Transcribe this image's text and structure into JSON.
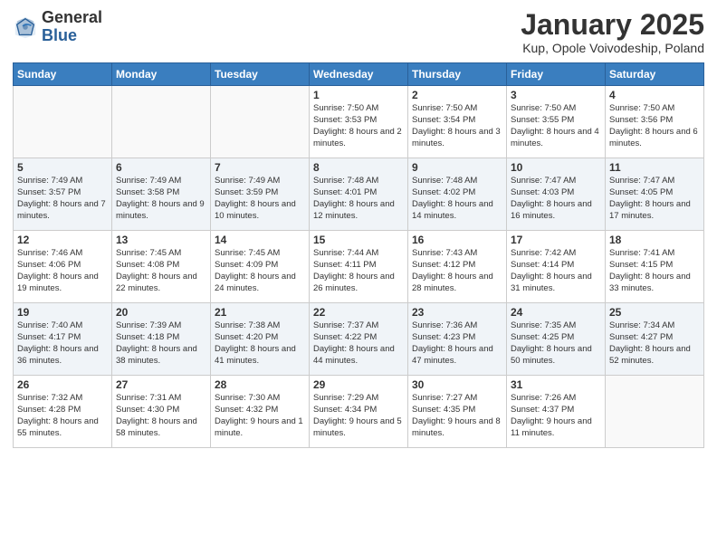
{
  "header": {
    "logo_general": "General",
    "logo_blue": "Blue",
    "month_title": "January 2025",
    "location": "Kup, Opole Voivodeship, Poland"
  },
  "weekdays": [
    "Sunday",
    "Monday",
    "Tuesday",
    "Wednesday",
    "Thursday",
    "Friday",
    "Saturday"
  ],
  "weeks": [
    [
      {
        "day": "",
        "info": ""
      },
      {
        "day": "",
        "info": ""
      },
      {
        "day": "",
        "info": ""
      },
      {
        "day": "1",
        "info": "Sunrise: 7:50 AM\nSunset: 3:53 PM\nDaylight: 8 hours and 2 minutes."
      },
      {
        "day": "2",
        "info": "Sunrise: 7:50 AM\nSunset: 3:54 PM\nDaylight: 8 hours and 3 minutes."
      },
      {
        "day": "3",
        "info": "Sunrise: 7:50 AM\nSunset: 3:55 PM\nDaylight: 8 hours and 4 minutes."
      },
      {
        "day": "4",
        "info": "Sunrise: 7:50 AM\nSunset: 3:56 PM\nDaylight: 8 hours and 6 minutes."
      }
    ],
    [
      {
        "day": "5",
        "info": "Sunrise: 7:49 AM\nSunset: 3:57 PM\nDaylight: 8 hours and 7 minutes."
      },
      {
        "day": "6",
        "info": "Sunrise: 7:49 AM\nSunset: 3:58 PM\nDaylight: 8 hours and 9 minutes."
      },
      {
        "day": "7",
        "info": "Sunrise: 7:49 AM\nSunset: 3:59 PM\nDaylight: 8 hours and 10 minutes."
      },
      {
        "day": "8",
        "info": "Sunrise: 7:48 AM\nSunset: 4:01 PM\nDaylight: 8 hours and 12 minutes."
      },
      {
        "day": "9",
        "info": "Sunrise: 7:48 AM\nSunset: 4:02 PM\nDaylight: 8 hours and 14 minutes."
      },
      {
        "day": "10",
        "info": "Sunrise: 7:47 AM\nSunset: 4:03 PM\nDaylight: 8 hours and 16 minutes."
      },
      {
        "day": "11",
        "info": "Sunrise: 7:47 AM\nSunset: 4:05 PM\nDaylight: 8 hours and 17 minutes."
      }
    ],
    [
      {
        "day": "12",
        "info": "Sunrise: 7:46 AM\nSunset: 4:06 PM\nDaylight: 8 hours and 19 minutes."
      },
      {
        "day": "13",
        "info": "Sunrise: 7:45 AM\nSunset: 4:08 PM\nDaylight: 8 hours and 22 minutes."
      },
      {
        "day": "14",
        "info": "Sunrise: 7:45 AM\nSunset: 4:09 PM\nDaylight: 8 hours and 24 minutes."
      },
      {
        "day": "15",
        "info": "Sunrise: 7:44 AM\nSunset: 4:11 PM\nDaylight: 8 hours and 26 minutes."
      },
      {
        "day": "16",
        "info": "Sunrise: 7:43 AM\nSunset: 4:12 PM\nDaylight: 8 hours and 28 minutes."
      },
      {
        "day": "17",
        "info": "Sunrise: 7:42 AM\nSunset: 4:14 PM\nDaylight: 8 hours and 31 minutes."
      },
      {
        "day": "18",
        "info": "Sunrise: 7:41 AM\nSunset: 4:15 PM\nDaylight: 8 hours and 33 minutes."
      }
    ],
    [
      {
        "day": "19",
        "info": "Sunrise: 7:40 AM\nSunset: 4:17 PM\nDaylight: 8 hours and 36 minutes."
      },
      {
        "day": "20",
        "info": "Sunrise: 7:39 AM\nSunset: 4:18 PM\nDaylight: 8 hours and 38 minutes."
      },
      {
        "day": "21",
        "info": "Sunrise: 7:38 AM\nSunset: 4:20 PM\nDaylight: 8 hours and 41 minutes."
      },
      {
        "day": "22",
        "info": "Sunrise: 7:37 AM\nSunset: 4:22 PM\nDaylight: 8 hours and 44 minutes."
      },
      {
        "day": "23",
        "info": "Sunrise: 7:36 AM\nSunset: 4:23 PM\nDaylight: 8 hours and 47 minutes."
      },
      {
        "day": "24",
        "info": "Sunrise: 7:35 AM\nSunset: 4:25 PM\nDaylight: 8 hours and 50 minutes."
      },
      {
        "day": "25",
        "info": "Sunrise: 7:34 AM\nSunset: 4:27 PM\nDaylight: 8 hours and 52 minutes."
      }
    ],
    [
      {
        "day": "26",
        "info": "Sunrise: 7:32 AM\nSunset: 4:28 PM\nDaylight: 8 hours and 55 minutes."
      },
      {
        "day": "27",
        "info": "Sunrise: 7:31 AM\nSunset: 4:30 PM\nDaylight: 8 hours and 58 minutes."
      },
      {
        "day": "28",
        "info": "Sunrise: 7:30 AM\nSunset: 4:32 PM\nDaylight: 9 hours and 1 minute."
      },
      {
        "day": "29",
        "info": "Sunrise: 7:29 AM\nSunset: 4:34 PM\nDaylight: 9 hours and 5 minutes."
      },
      {
        "day": "30",
        "info": "Sunrise: 7:27 AM\nSunset: 4:35 PM\nDaylight: 9 hours and 8 minutes."
      },
      {
        "day": "31",
        "info": "Sunrise: 7:26 AM\nSunset: 4:37 PM\nDaylight: 9 hours and 11 minutes."
      },
      {
        "day": "",
        "info": ""
      }
    ]
  ]
}
